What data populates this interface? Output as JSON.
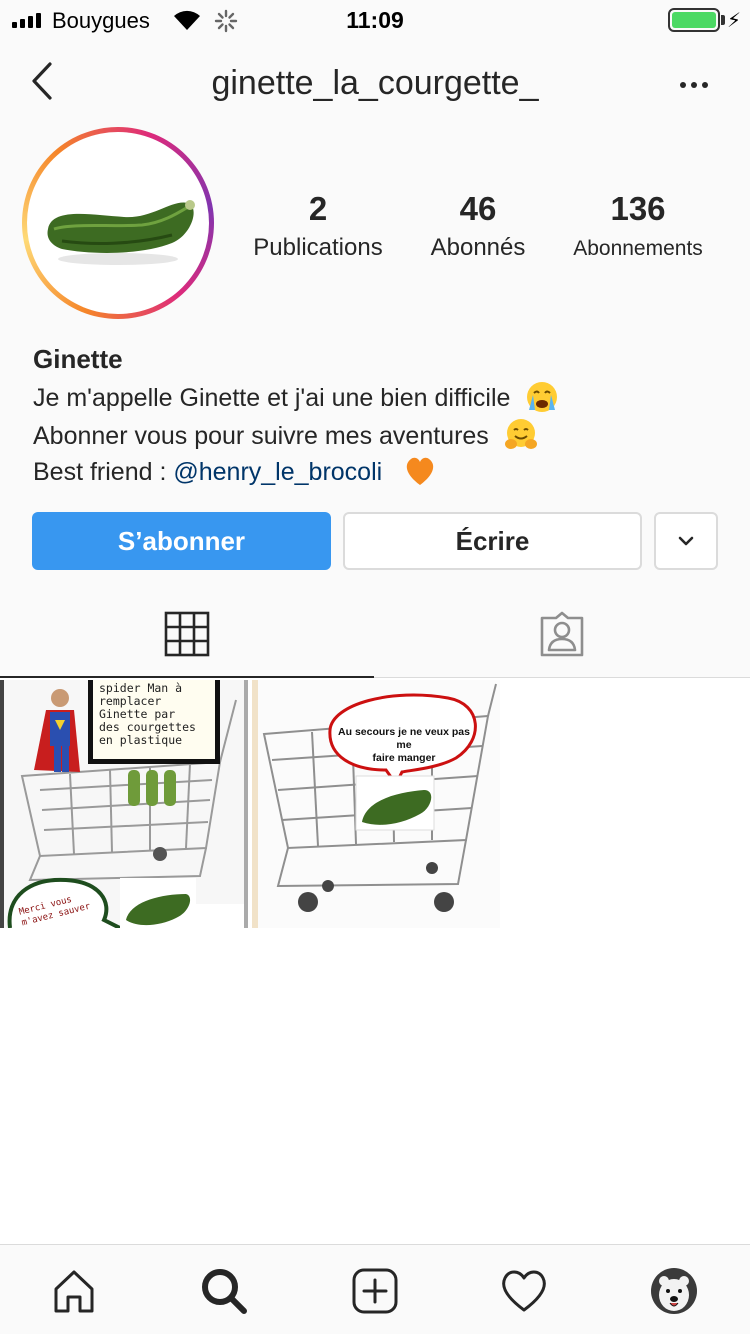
{
  "status_bar": {
    "carrier": "Bouygues",
    "time": "11:09",
    "battery_level": 1.0
  },
  "header": {
    "username": "ginette_la_courgette_",
    "back_icon": "chevron-left-icon",
    "more_icon": "more-horizontal-icon"
  },
  "profile": {
    "stats": {
      "posts_count": "2",
      "posts_label": "Publications",
      "followers_count": "46",
      "followers_label": "Abonnés",
      "following_count": "136",
      "following_label": "Abonnements"
    },
    "display_name": "Ginette",
    "bio": {
      "line1": "Je m'appelle Ginette et j'ai une bien difficile",
      "line1_emoji": "crying-face",
      "line2": "Abonner vous pour suivre mes aventures",
      "line2_emoji": "hugging-face",
      "line3_prefix": "Best friend : ",
      "line3_mention": "@henry_le_brocoli",
      "line3_emoji": "orange-heart"
    }
  },
  "actions": {
    "follow_label": "S’abonner",
    "message_label": "Écrire",
    "dropdown_icon": "chevron-down-icon"
  },
  "tabs": [
    {
      "name": "grid",
      "icon": "grid-icon",
      "active": true
    },
    {
      "name": "tagged",
      "icon": "tagged-person-icon",
      "active": false
    }
  ],
  "posts": [
    {
      "caption": [
        "spider Man à",
        "remplacer",
        "Ginette par",
        "des courgettes",
        "en plastique"
      ],
      "speech": [
        "Merci vous",
        "m'avez sauver"
      ]
    },
    {
      "speech": [
        "Au secours je ne veux pas me",
        "faire manger"
      ]
    }
  ],
  "bottom_nav": [
    {
      "name": "home",
      "icon": "home-icon"
    },
    {
      "name": "search",
      "icon": "search-icon",
      "active": true
    },
    {
      "name": "new-post",
      "icon": "plus-square-icon"
    },
    {
      "name": "activity",
      "icon": "heart-icon"
    },
    {
      "name": "profile",
      "icon": "avatar-icon"
    }
  ],
  "colors": {
    "primary_button": "#3897f0",
    "mention": "#003569",
    "text": "#262626",
    "border": "#dbdbdb"
  }
}
